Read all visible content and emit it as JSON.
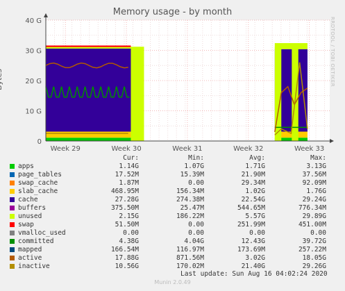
{
  "header": {
    "title": "Memory usage - by month",
    "ylabel": "Bytes",
    "side_text": "RRDTOOL / TOBI OETIKER"
  },
  "chart_data": {
    "type": "area",
    "title": "Memory usage - by month",
    "ylabel": "Bytes",
    "ylim": [
      0,
      40
    ],
    "y_unit": "G",
    "yticks": [
      "0",
      "10 G",
      "20 G",
      "30 G",
      "40 G"
    ],
    "xticks": [
      "Week 29",
      "Week 30",
      "Week 31",
      "Week 32",
      "Week 33"
    ],
    "grid": true,
    "series": [
      {
        "name": "apps",
        "color": "#00cc00",
        "segments": [
          {
            "x": [
              0,
              130
            ],
            "y": [
              1.1,
              1.1
            ]
          },
          {
            "x": [
              350,
              400
            ],
            "y": [
              1.1,
              1.1
            ]
          }
        ]
      },
      {
        "name": "page_tables",
        "color": "#0066b3",
        "segments": []
      },
      {
        "name": "swap_cache",
        "color": "#ff8000",
        "segments": []
      },
      {
        "name": "slab_cache",
        "color": "#ffcc00",
        "segments": [
          {
            "x": [
              0,
              130
            ],
            "y": [
              2.0,
              2.0
            ]
          },
          {
            "x": [
              350,
              400
            ],
            "y": [
              2.0,
              2.0
            ]
          }
        ]
      },
      {
        "name": "cache",
        "color": "#330099",
        "segments": [
          {
            "x": [
              0,
              130
            ],
            "y": [
              27.5,
              27.5
            ]
          },
          {
            "x": [
              350,
              400
            ],
            "y": [
              27.3,
              27.3
            ]
          }
        ]
      },
      {
        "name": "buffers",
        "color": "#990099",
        "segments": []
      },
      {
        "name": "unused",
        "color": "#ccff00",
        "segments": [
          {
            "x": [
              0,
              130
            ],
            "y": [
              0.5,
              0.5
            ]
          },
          {
            "x": [
              350,
              400
            ],
            "y": [
              2.0,
              2.0
            ]
          }
        ]
      },
      {
        "name": "swap",
        "color": "#ff0000",
        "segments": [
          {
            "x": [
              0,
              130
            ],
            "y": [
              0.5,
              0.5
            ]
          }
        ]
      },
      {
        "name": "vmalloc_used",
        "color": "#808080",
        "segments": []
      },
      {
        "name": "committed",
        "color": "#008f00",
        "segments": [
          {
            "x": [
              0,
              130
            ],
            "y": [
              14.5,
              14.5
            ]
          },
          {
            "x": [
              350,
              400
            ],
            "y": [
              4.5,
              4.5
            ]
          }
        ]
      },
      {
        "name": "mapped",
        "color": "#00487d",
        "segments": []
      },
      {
        "name": "active",
        "color": "#b35a00",
        "segments": [
          {
            "x": [
              0,
              130
            ],
            "y": [
              25.3,
              25.3
            ]
          },
          {
            "x": [
              350,
              400
            ],
            "y": [
              16.0,
              16.0
            ]
          }
        ]
      },
      {
        "name": "inactive",
        "color": "#b38f00",
        "segments": [
          {
            "x": [
              0,
              130
            ],
            "y": [
              2.5,
              2.5
            ]
          },
          {
            "x": [
              350,
              400
            ],
            "y": [
              4.0,
              4.0
            ]
          }
        ]
      }
    ]
  },
  "legend": {
    "headers": {
      "cur": "Cur:",
      "min": "Min:",
      "avg": "Avg:",
      "max": "Max:"
    },
    "rows": [
      {
        "name": "apps",
        "color": "#00cc00",
        "cur": "1.14G",
        "min": "1.07G",
        "avg": "1.71G",
        "max": "3.13G"
      },
      {
        "name": "page_tables",
        "color": "#0066b3",
        "cur": "17.52M",
        "min": "15.39M",
        "avg": "21.90M",
        "max": "37.56M"
      },
      {
        "name": "swap_cache",
        "color": "#ff8000",
        "cur": "1.87M",
        "min": "0.00",
        "avg": "29.34M",
        "max": "92.09M"
      },
      {
        "name": "slab_cache",
        "color": "#ffcc00",
        "cur": "468.95M",
        "min": "156.34M",
        "avg": "1.02G",
        "max": "1.76G"
      },
      {
        "name": "cache",
        "color": "#330099",
        "cur": "27.28G",
        "min": "274.38M",
        "avg": "22.54G",
        "max": "29.24G"
      },
      {
        "name": "buffers",
        "color": "#990099",
        "cur": "375.50M",
        "min": "25.47M",
        "avg": "544.65M",
        "max": "776.34M"
      },
      {
        "name": "unused",
        "color": "#ccff00",
        "cur": "2.15G",
        "min": "186.22M",
        "avg": "5.57G",
        "max": "29.89G"
      },
      {
        "name": "swap",
        "color": "#ff0000",
        "cur": "51.50M",
        "min": "0.00",
        "avg": "251.99M",
        "max": "451.00M"
      },
      {
        "name": "vmalloc_used",
        "color": "#808080",
        "cur": "0.00",
        "min": "0.00",
        "avg": "0.00",
        "max": "0.00"
      },
      {
        "name": "committed",
        "color": "#008f00",
        "cur": "4.38G",
        "min": "4.04G",
        "avg": "12.43G",
        "max": "39.72G"
      },
      {
        "name": "mapped",
        "color": "#00487d",
        "cur": "166.54M",
        "min": "116.97M",
        "avg": "173.69M",
        "max": "257.22M"
      },
      {
        "name": "active",
        "color": "#b35a00",
        "cur": "17.88G",
        "min": "871.56M",
        "avg": "3.02G",
        "max": "18.05G"
      },
      {
        "name": "inactive",
        "color": "#b38f00",
        "cur": "10.56G",
        "min": "170.02M",
        "avg": "21.40G",
        "max": "29.26G"
      }
    ]
  },
  "footer": {
    "last_update": "Last update: Sun Aug 16 04:02:24 2020",
    "munin": "Munin 2.0.49"
  }
}
